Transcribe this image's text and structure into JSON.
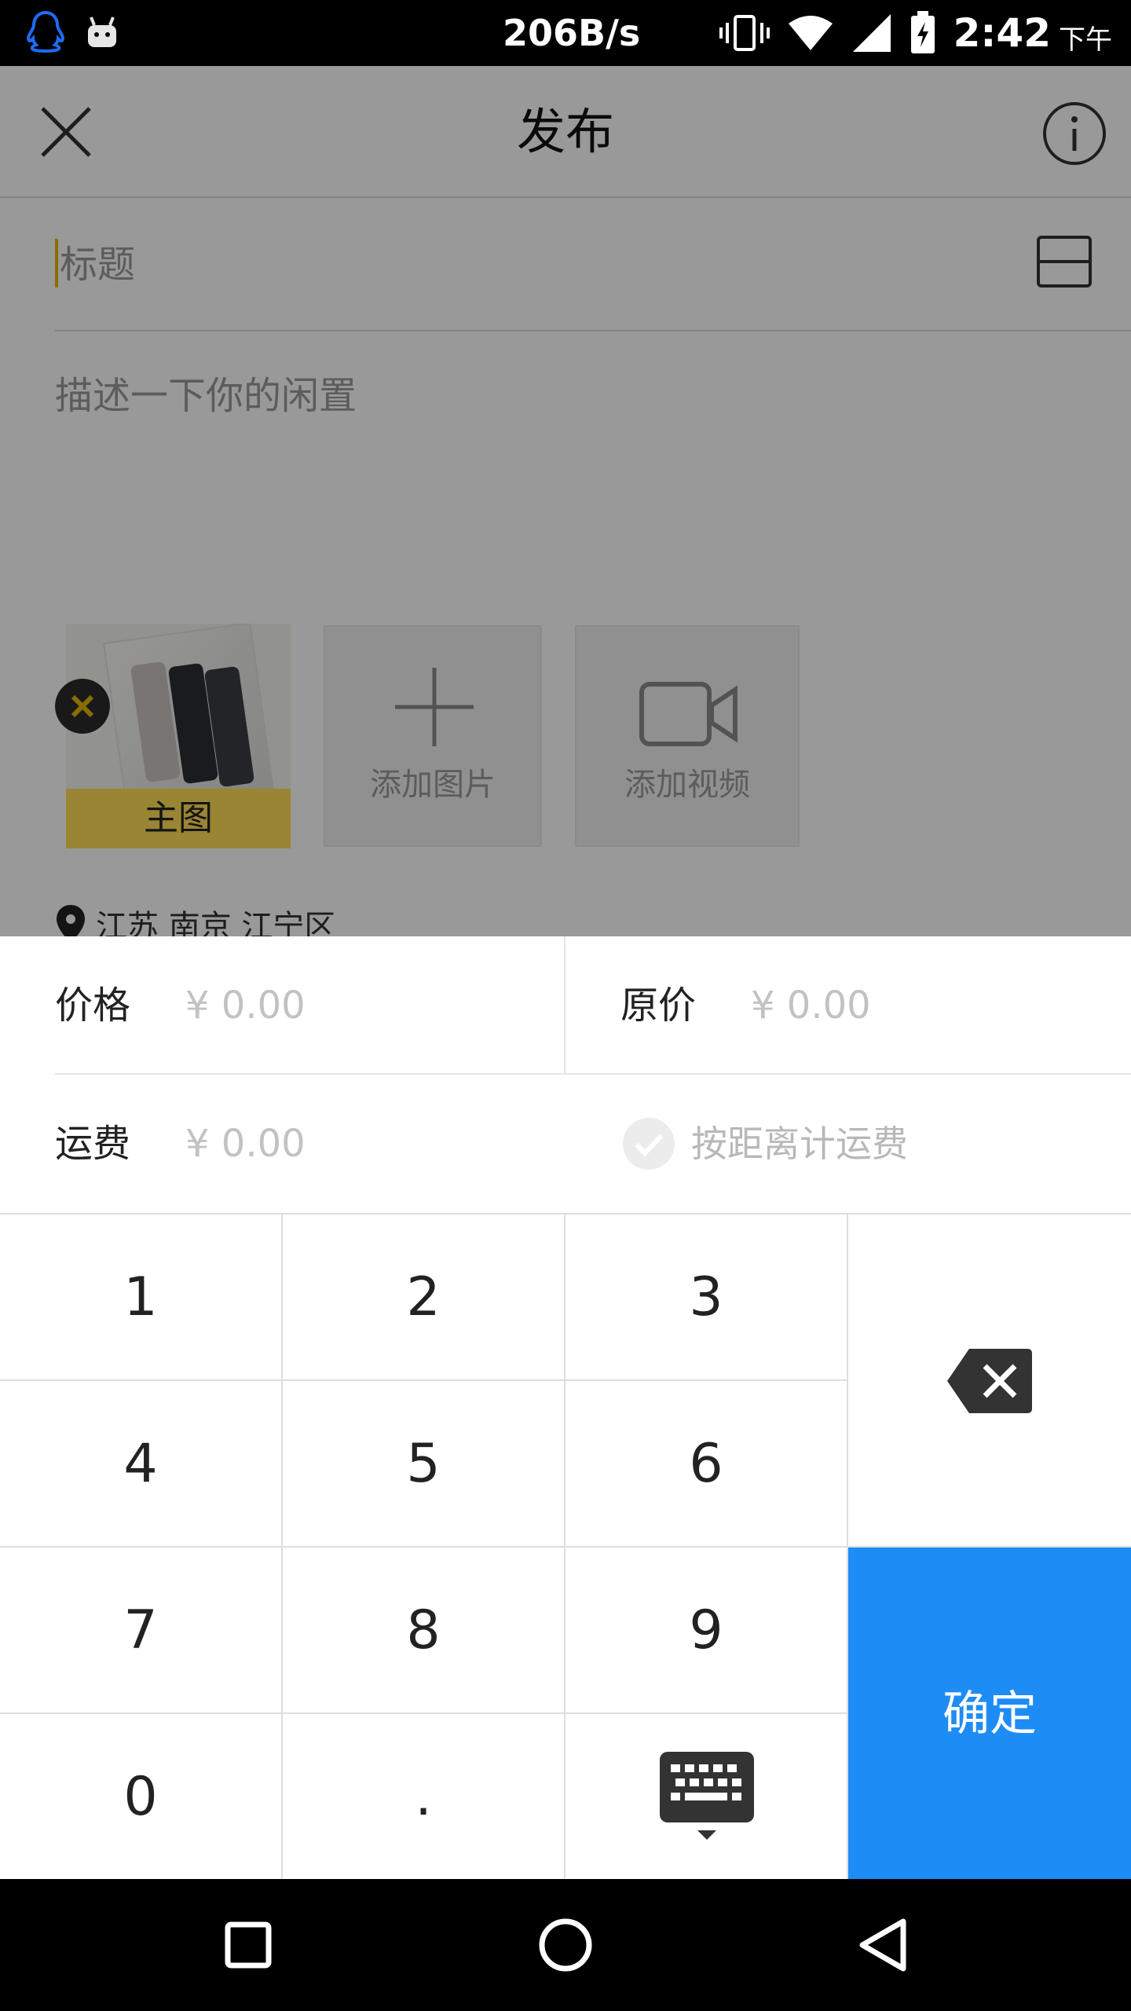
{
  "status_bar": {
    "net_speed": "206B/s",
    "time": "2:42",
    "ampm": "下午",
    "left_icons": [
      "qq-icon",
      "android-robot-icon"
    ],
    "right_icons": [
      "vibrate-icon",
      "wifi-icon",
      "signal-icon",
      "battery-charging-icon"
    ]
  },
  "header": {
    "title": "发布"
  },
  "form": {
    "title_placeholder": "标题",
    "description_placeholder": "描述一下你的闲置",
    "main_image_label": "主图",
    "add_image_label": "添加图片",
    "add_video_label": "添加视频",
    "location": "江苏 南京 江宁区"
  },
  "price_sheet": {
    "price_label": "价格",
    "price_placeholder": "¥ 0.00",
    "original_price_label": "原价",
    "original_price_placeholder": "¥ 0.00",
    "shipping_label": "运费",
    "shipping_placeholder": "¥ 0.00",
    "distance_shipping_label": "按距离计运费"
  },
  "keypad": {
    "keys": [
      "1",
      "2",
      "3",
      "4",
      "5",
      "6",
      "7",
      "8",
      "9",
      "0",
      "."
    ],
    "confirm_label": "确定"
  },
  "colors": {
    "accent_blue": "#1e8cf5",
    "main_badge_yellow": "#ffde55",
    "delete_badge_x": "#e8b400"
  }
}
